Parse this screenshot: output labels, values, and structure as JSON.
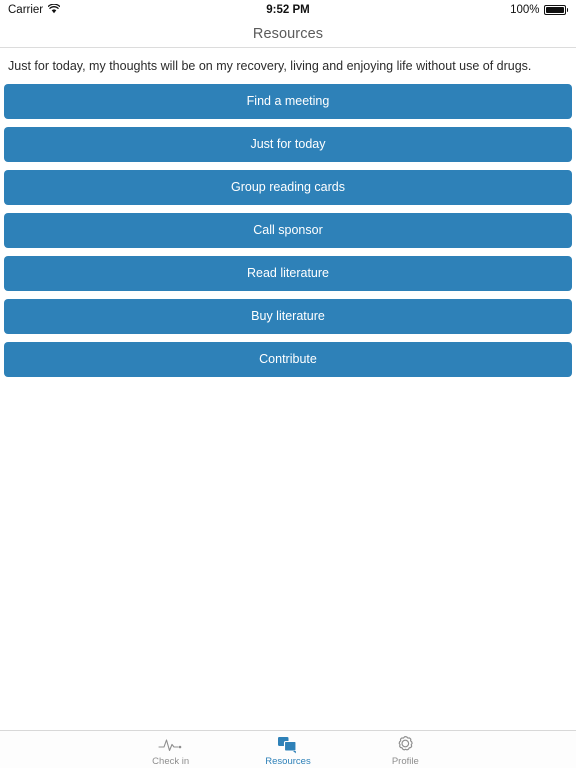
{
  "status_bar": {
    "carrier": "Carrier",
    "wifi_icon": "wifi-icon",
    "time": "9:52 PM",
    "battery_percent": "100%",
    "battery_icon": "battery-full-icon"
  },
  "nav_bar": {
    "title": "Resources"
  },
  "main": {
    "quote": "Just for today, my thoughts will be on my recovery, living and enjoying life without use of drugs.",
    "buttons": [
      {
        "label": "Find a meeting"
      },
      {
        "label": "Just for today"
      },
      {
        "label": "Group reading cards"
      },
      {
        "label": "Call sponsor"
      },
      {
        "label": "Read literature"
      },
      {
        "label": "Buy literature"
      },
      {
        "label": "Contribute"
      }
    ]
  },
  "tab_bar": {
    "tabs": [
      {
        "label": "Check in",
        "icon": "pulse-icon",
        "active": false
      },
      {
        "label": "Resources",
        "icon": "chat-bubbles-icon",
        "active": true
      },
      {
        "label": "Profile",
        "icon": "gear-icon",
        "active": false
      }
    ]
  },
  "colors": {
    "accent": "#2e81b8",
    "button_text": "#ffffff",
    "tab_inactive": "#8e8e8e",
    "nav_title": "#5b5b5b"
  }
}
